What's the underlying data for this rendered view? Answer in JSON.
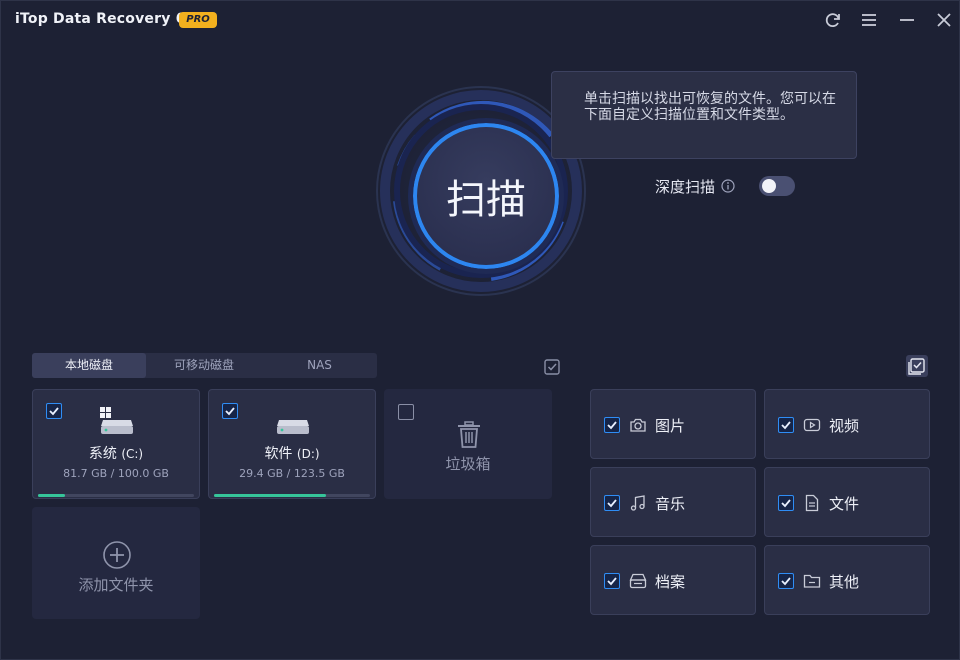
{
  "titlebar": {
    "app_title": "iTop Data Recovery 6.1",
    "badge": "PRO",
    "buttons": [
      "refresh-icon",
      "menu-icon",
      "minimize-icon",
      "close-icon"
    ]
  },
  "scan": {
    "button_label": "扫描",
    "tooltip": "单击扫描以找出可恢复的文件。您可以在下面自定义扫描位置和文件类型。",
    "deep_scan_label": "深度扫描",
    "deep_scan_enabled": false
  },
  "location_tabs": [
    {
      "label": "本地磁盘",
      "active": true
    },
    {
      "label": "可移动磁盘",
      "active": false
    },
    {
      "label": "NAS",
      "active": false
    }
  ],
  "drives": [
    {
      "name": "系统",
      "letter": "(C:)",
      "size": "81.7 GB / 100.0 GB",
      "used_fraction": 0.17,
      "checked": true,
      "icon": "windows-drive-icon"
    },
    {
      "name": "软件",
      "letter": "(D:)",
      "size": "29.4 GB / 123.5 GB",
      "used_fraction": 0.72,
      "checked": true,
      "icon": "hard-drive-icon"
    }
  ],
  "trash": {
    "label": "垃圾箱",
    "checked": false,
    "icon": "trash-icon"
  },
  "add_folder": {
    "label": "添加文件夹",
    "icon": "plus-circle-icon"
  },
  "file_types": [
    {
      "label": "图片",
      "icon": "camera-icon",
      "checked": true
    },
    {
      "label": "视频",
      "icon": "video-icon",
      "checked": true
    },
    {
      "label": "音乐",
      "icon": "music-icon",
      "checked": true
    },
    {
      "label": "文件",
      "icon": "document-icon",
      "checked": true
    },
    {
      "label": "档案",
      "icon": "archive-icon",
      "checked": true
    },
    {
      "label": "其他",
      "icon": "folder-icon",
      "checked": true
    }
  ],
  "colors": {
    "background": "#1d2134",
    "card": "#2a2e45",
    "accent_blue": "#2f8df5",
    "progress_green": "#36c59a",
    "pro_badge": "#f2b01e"
  }
}
